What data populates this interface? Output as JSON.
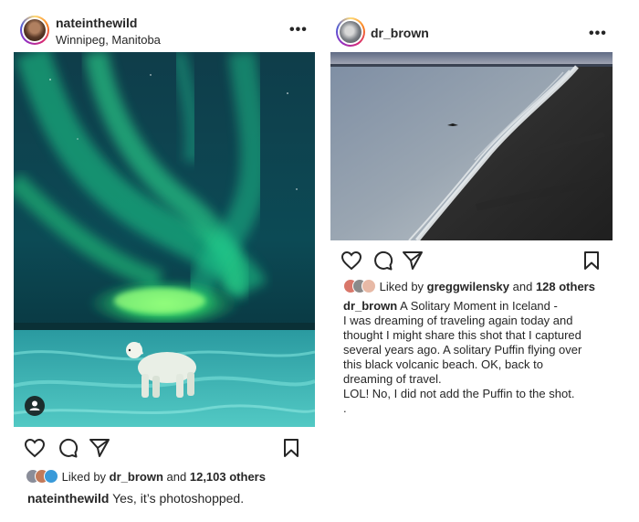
{
  "post_left": {
    "username": "nateinthewild",
    "location": "Winnipeg, Manitoba",
    "more_label": "•••",
    "photo_description_icon": "person-tag-icon",
    "likes": {
      "prefix": "Liked by",
      "user": "dr_brown",
      "joiner": "and",
      "count": "12,103 others"
    },
    "caption": {
      "user": "nateinthewild",
      "text": "Yes, it’s photoshopped."
    },
    "icons": [
      "heart-icon",
      "comment-icon",
      "share-icon",
      "bookmark-icon"
    ]
  },
  "post_right": {
    "username": "dr_brown",
    "more_label": "•••",
    "likes": {
      "prefix": "Liked by",
      "user": "greggwilensky",
      "joiner": "and",
      "count": "128 others"
    },
    "caption": {
      "user": "dr_brown",
      "first_line": "A Solitary Moment in Iceland -",
      "lines": [
        "I was dreaming of traveling again today and",
        "thought I might share this shot that I captured",
        "several years ago. A solitary Puffin flying over",
        "this black volcanic beach. OK, back to",
        "dreaming of travel.",
        "LOL! No, I did not add the Puffin to the shot.",
        "."
      ]
    },
    "icons": [
      "heart-icon",
      "comment-icon",
      "share-icon",
      "bookmark-icon"
    ]
  },
  "colors": {
    "text": "#262626",
    "aurora_green": "#2de07a",
    "ice_teal": "#3fb8b3",
    "sand_black": "#2a2a2a"
  }
}
